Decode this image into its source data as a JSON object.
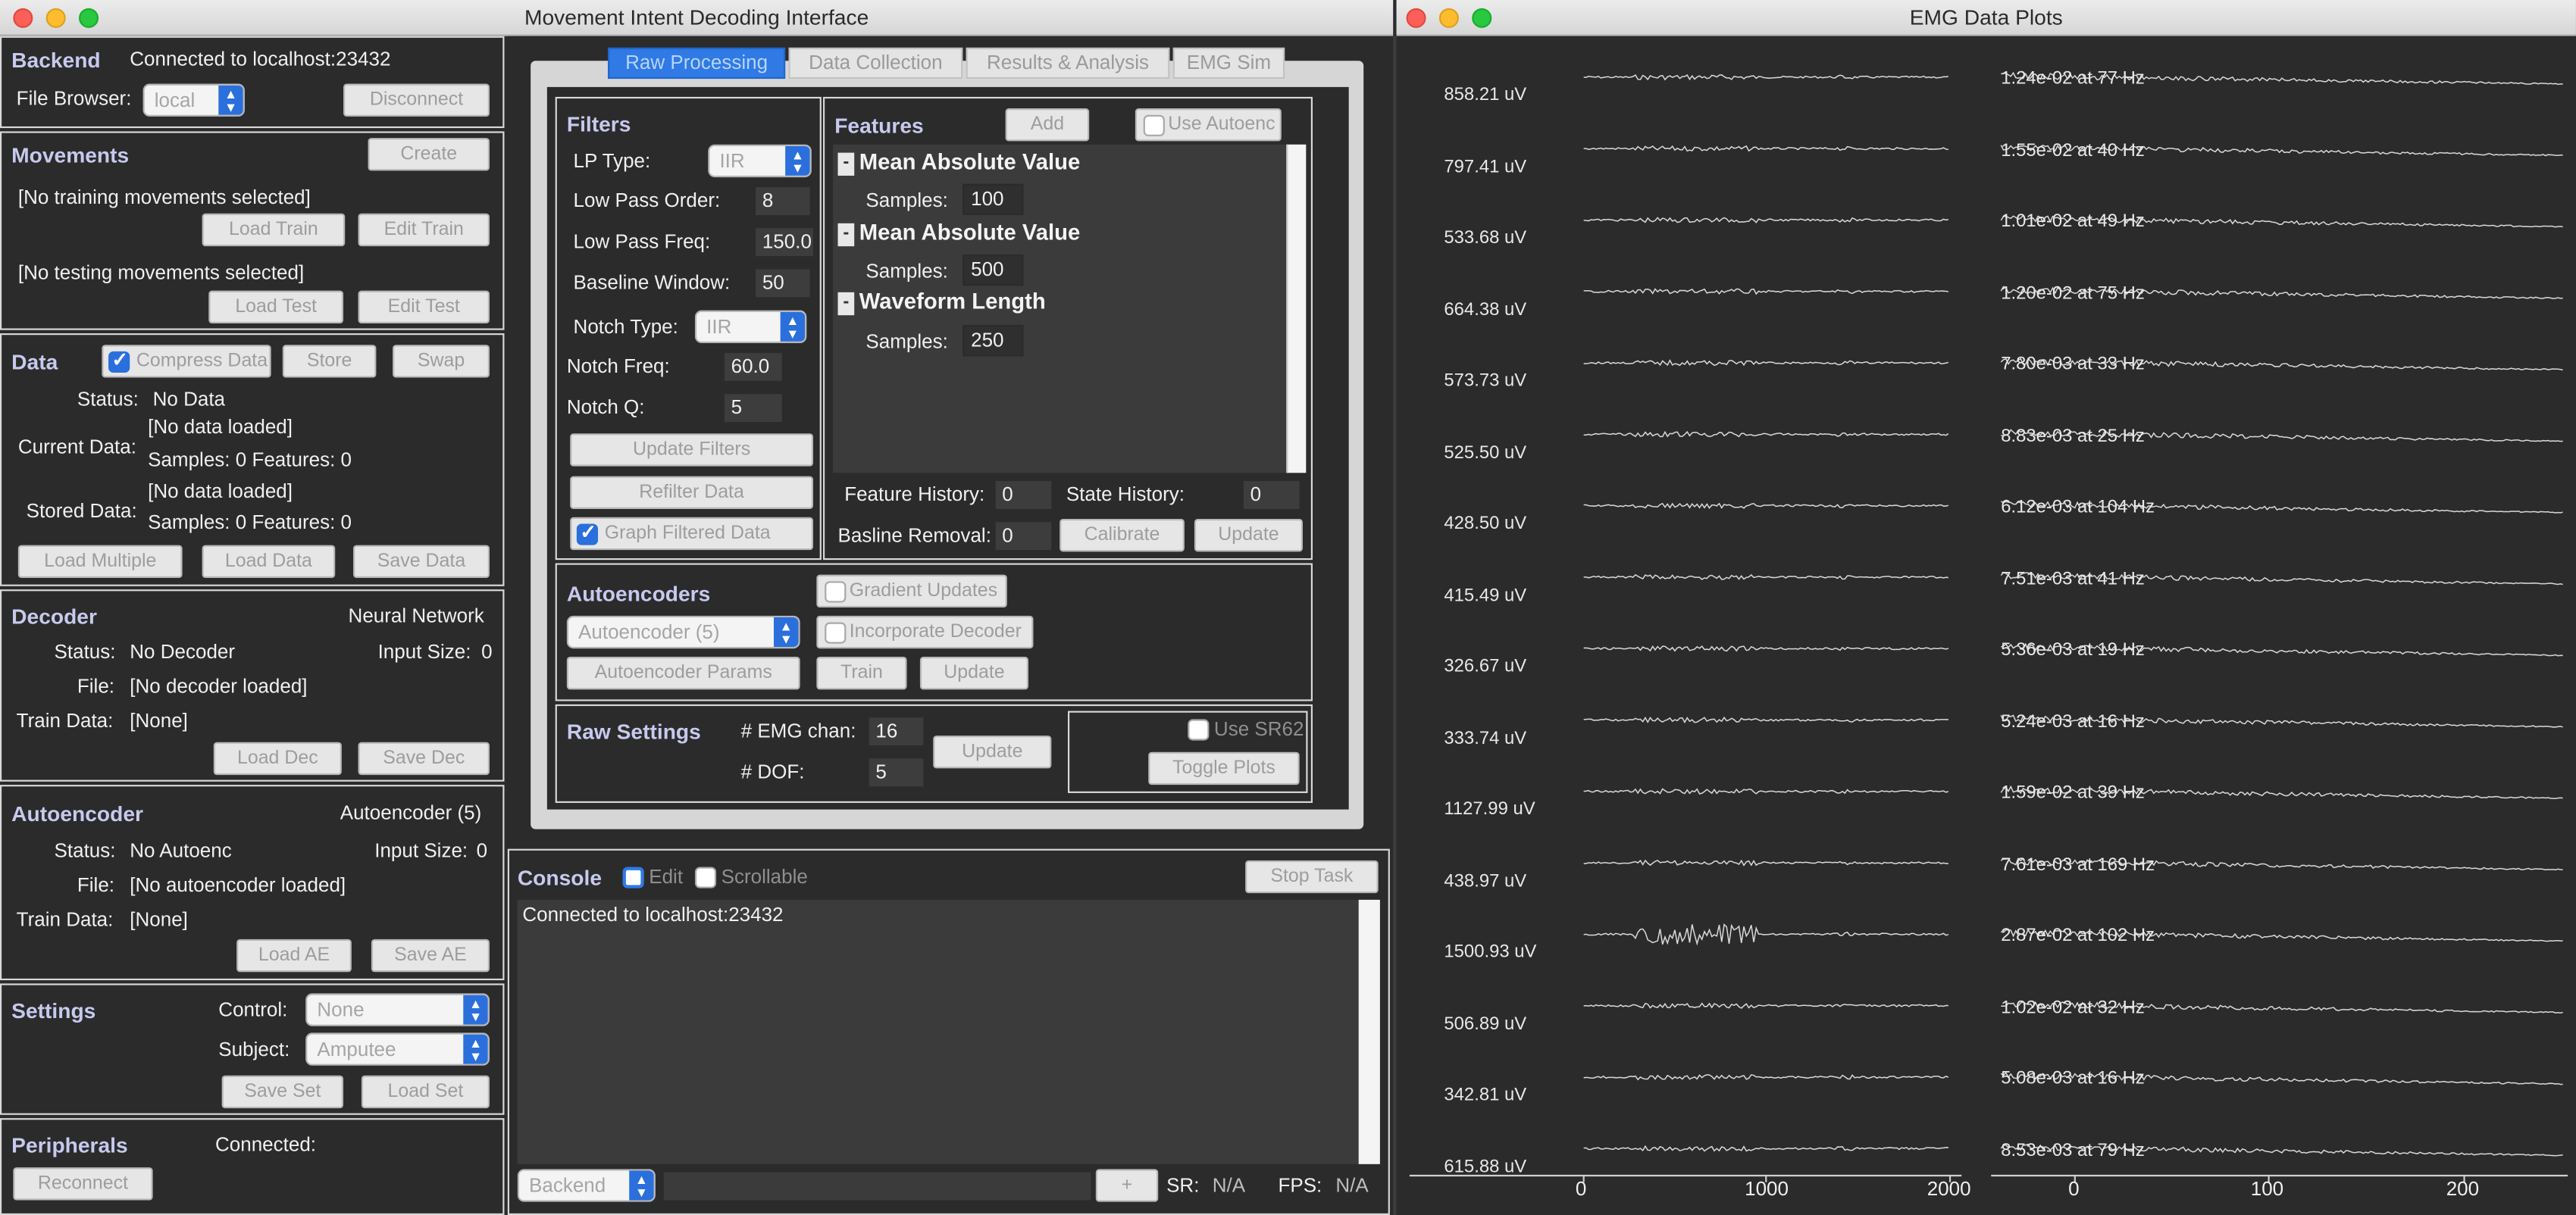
{
  "windows": {
    "left_title": "Movement Intent Decoding Interface",
    "right_title": "EMG Data Plots"
  },
  "backend": {
    "header": "Backend",
    "status": "Connected to localhost:23432",
    "file_browser_label": "File Browser:",
    "file_browser_value": "local",
    "disconnect": "Disconnect"
  },
  "movements": {
    "header": "Movements",
    "create": "Create",
    "training_status": "[No training movements selected]",
    "load_train": "Load Train",
    "edit_train": "Edit Train",
    "testing_status": "[No testing movements selected]",
    "load_test": "Load Test",
    "edit_test": "Edit Test"
  },
  "data": {
    "header": "Data",
    "compress_label": "Compress Data",
    "compress_checked": true,
    "store": "Store",
    "swap": "Swap",
    "status_label": "Status:",
    "status_value": "No Data",
    "current_label": "Current Data:",
    "current_value": "[No data loaded]",
    "current_counts": "Samples: 0  Features: 0",
    "stored_label": "Stored Data:",
    "stored_value": "[No data loaded]",
    "stored_counts": "Samples: 0  Features: 0",
    "load_multiple": "Load Multiple",
    "load_data": "Load Data",
    "save_data": "Save Data"
  },
  "decoder": {
    "header": "Decoder",
    "type": "Neural Network",
    "status_label": "Status:",
    "status_value": "No Decoder",
    "input_label": "Input Size:",
    "input_value": "0",
    "file_label": "File:",
    "file_value": "[No decoder loaded]",
    "train_label": "Train Data:",
    "train_value": "[None]",
    "load": "Load Dec",
    "save": "Save Dec"
  },
  "autoencoder": {
    "header": "Autoencoder",
    "type": "Autoencoder (5)",
    "status_label": "Status:",
    "status_value": "No Autoenc",
    "input_label": "Input Size:",
    "input_value": "0",
    "file_label": "File:",
    "file_value": "[No autoencoder loaded]",
    "train_label": "Train Data:",
    "train_value": "[None]",
    "load": "Load AE",
    "save": "Save AE"
  },
  "settings": {
    "header": "Settings",
    "control_label": "Control:",
    "control_value": "None",
    "subject_label": "Subject:",
    "subject_value": "Amputee",
    "save": "Save Set",
    "load": "Load Set"
  },
  "peripherals": {
    "header": "Peripherals",
    "connected_label": "Connected:",
    "reconnect": "Reconnect"
  },
  "tabs": [
    "Raw Processing",
    "Data Collection",
    "Results & Analysis",
    "EMG Sim"
  ],
  "filters": {
    "header": "Filters",
    "lp_type_label": "LP Type:",
    "lp_type_value": "IIR",
    "lp_order_label": "Low Pass Order:",
    "lp_order_value": "8",
    "lp_freq_label": "Low Pass Freq:",
    "lp_freq_value": "150.0",
    "baseline_label": "Baseline Window:",
    "baseline_value": "50",
    "notch_type_label": "Notch Type:",
    "notch_type_value": "IIR",
    "notch_freq_label": "Notch Freq:",
    "notch_freq_value": "60.0",
    "notch_q_label": "Notch Q:",
    "notch_q_value": "5",
    "update_filters": "Update Filters",
    "refilter": "Refilter Data",
    "graph_filtered": "Graph Filtered Data",
    "graph_filtered_checked": true
  },
  "features": {
    "header": "Features",
    "add": "Add",
    "use_autoenc": "Use Autoenc",
    "items": [
      {
        "name": "Mean Absolute Value",
        "samples_label": "Samples:",
        "samples": "100"
      },
      {
        "name": "Mean Absolute Value",
        "samples_label": "Samples:",
        "samples": "500"
      },
      {
        "name": "Waveform Length",
        "samples_label": "Samples:",
        "samples": "250"
      }
    ],
    "feature_history_label": "Feature History:",
    "feature_history": "0",
    "state_history_label": "State History:",
    "state_history": "0",
    "baseline_removal_label": "Basline Removal:",
    "baseline_removal": "0",
    "calibrate": "Calibrate",
    "update": "Update"
  },
  "autoencoders": {
    "header": "Autoencoders",
    "gradient_updates": "Gradient Updates",
    "incorporate_decoder": "Incorporate Decoder",
    "select_value": "Autoencoder (5)",
    "params": "Autoencoder Params",
    "train": "Train",
    "update": "Update"
  },
  "raw_settings": {
    "header": "Raw Settings",
    "emg_label": "# EMG chan:",
    "emg_value": "16",
    "dof_label": "# DOF:",
    "dof_value": "5",
    "update": "Update",
    "use_sr62": "Use SR62",
    "toggle_plots": "Toggle Plots"
  },
  "console": {
    "header": "Console",
    "edit": "Edit",
    "scrollable": "Scrollable",
    "stop_task": "Stop Task",
    "text": "Connected to localhost:23432",
    "target_value": "Backend",
    "send": "+",
    "sr_label": "SR:",
    "sr_value": "N/A",
    "fps_label": "FPS:",
    "fps_value": "N/A"
  },
  "plots": {
    "amplitudes": [
      "858.21 uV",
      "797.41 uV",
      "533.68 uV",
      "664.38 uV",
      "573.73 uV",
      "525.50 uV",
      "428.50 uV",
      "415.49 uV",
      "326.67 uV",
      "333.74 uV",
      "1127.99 uV",
      "438.97 uV",
      "1500.93 uV",
      "506.89 uV",
      "342.81 uV",
      "615.88 uV"
    ],
    "peaks": [
      "1.24e-02 at 77 Hz",
      "1.55e-02 at 40 Hz",
      "1.01e-02 at 49 Hz",
      "1.20e-02 at 75 Hz",
      "7.80e-03 at 33 Hz",
      "8.83e-03 at 25 Hz",
      "6.12e-03 at 104 Hz",
      "7.51e-03 at 41 Hz",
      "5.36e-03 at 19 Hz",
      "5.24e-03 at 16 Hz",
      "1.59e-02 at 39 Hz",
      "7.61e-03 at 169 Hz",
      "2.87e-02 at 102 Hz",
      "1.02e-02 at 32 Hz",
      "5.08e-03 at 16 Hz",
      "8.53e-03 at 79 Hz"
    ],
    "time_ticks": [
      "0",
      "1000",
      "2000"
    ],
    "freq_ticks": [
      "0",
      "100",
      "200"
    ],
    "trace_color": "#d8d8d8"
  }
}
